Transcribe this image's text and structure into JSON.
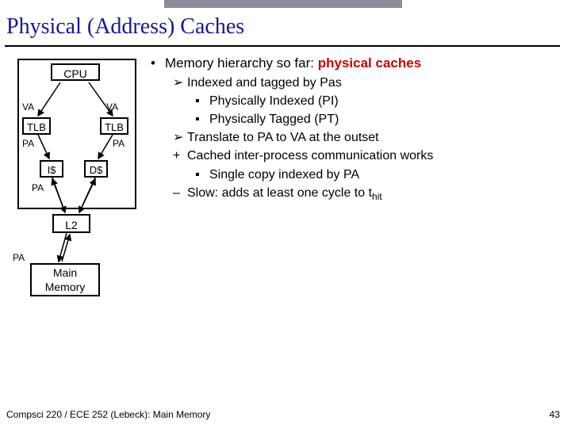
{
  "title": "Physical (Address) Caches",
  "bullets": {
    "main": "Memory hierarchy so far: ",
    "main_emph": "physical caches",
    "b1": "Indexed and tagged by Pas",
    "b1a": "Physically Indexed (PI)",
    "b1b": "Physically Tagged (PT)",
    "b2": "Translate to PA to VA at the outset",
    "b3": "Cached inter-process communication works",
    "b3a": "Single copy indexed by PA",
    "b4_pre": "Slow: adds at least one cycle to t",
    "b4_sub": "hit"
  },
  "diagram": {
    "cpu": "CPU",
    "va": "VA",
    "tlb": "TLB",
    "pa": "PA",
    "icache": "I$",
    "dcache": "D$",
    "l2": "L2",
    "mem_l1": "Main",
    "mem_l2": "Memory"
  },
  "footer": "Compsci 220 / ECE 252 (Lebeck): Main Memory",
  "page": "43"
}
